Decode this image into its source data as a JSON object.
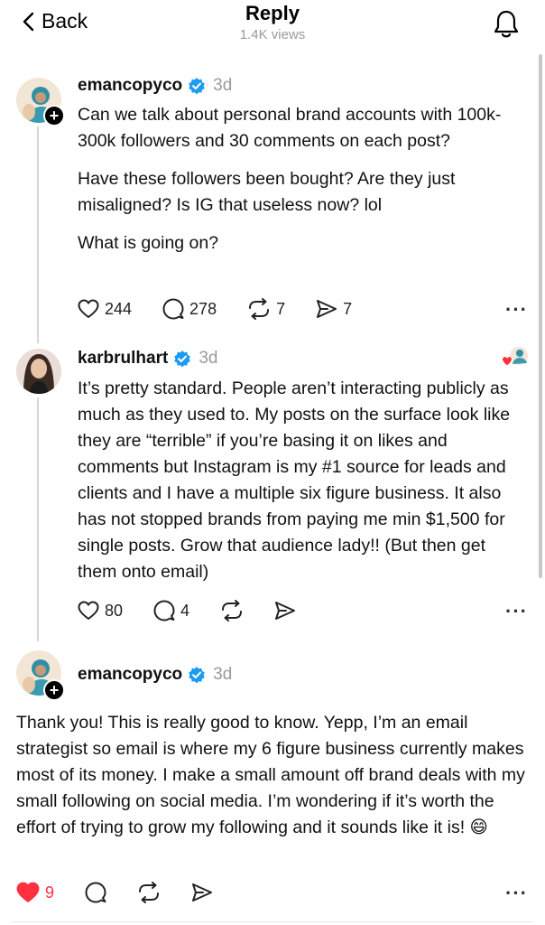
{
  "header": {
    "back_label": "Back",
    "title": "Reply",
    "views": "1.4K views"
  },
  "posts": [
    {
      "username": "emancopyco",
      "time": "3d",
      "paragraphs": [
        "Can we talk about personal brand accounts with 100k-300k followers and 30 comments on each post?",
        "Have these followers been bought? Are they just misaligned? Is IG that useless now? lol",
        "What is going on?"
      ],
      "likes": "244",
      "comments": "278",
      "reposts": "7",
      "shares": "7"
    },
    {
      "username": "karbrulhart",
      "time": "3d",
      "text": "It’s pretty standard. People aren’t interacting publicly as much as they used to. My posts on the surface look like they are “terrible” if you’re basing it on likes and comments but Instagram is my #1 source for leads and clients and I have a multiple six figure business. It also has not stopped brands from paying me min $1,500 for single posts. Grow that audience lady!! (But then get them onto email)",
      "likes": "80",
      "comments": "4"
    },
    {
      "username": "emancopyco",
      "time": "3d",
      "text": "Thank you! This is really good to know. Yepp, I’m an email strategist so email is where my 6 figure business currently makes most of its money. I make a small amount off brand deals with my small following on social media. I’m wondering if it’s worth the effort of trying to grow my following and it sounds like it is! 😄",
      "likes": "9"
    }
  ],
  "colors": {
    "verified_blue": "#1d9bf0",
    "liked_red": "#ff3040",
    "muted_gray": "#9a9a9a"
  },
  "icons": [
    "chevron-left-icon",
    "bell-icon",
    "verified-icon",
    "heart-icon",
    "comment-icon",
    "repost-icon",
    "share-icon",
    "more-icon"
  ]
}
